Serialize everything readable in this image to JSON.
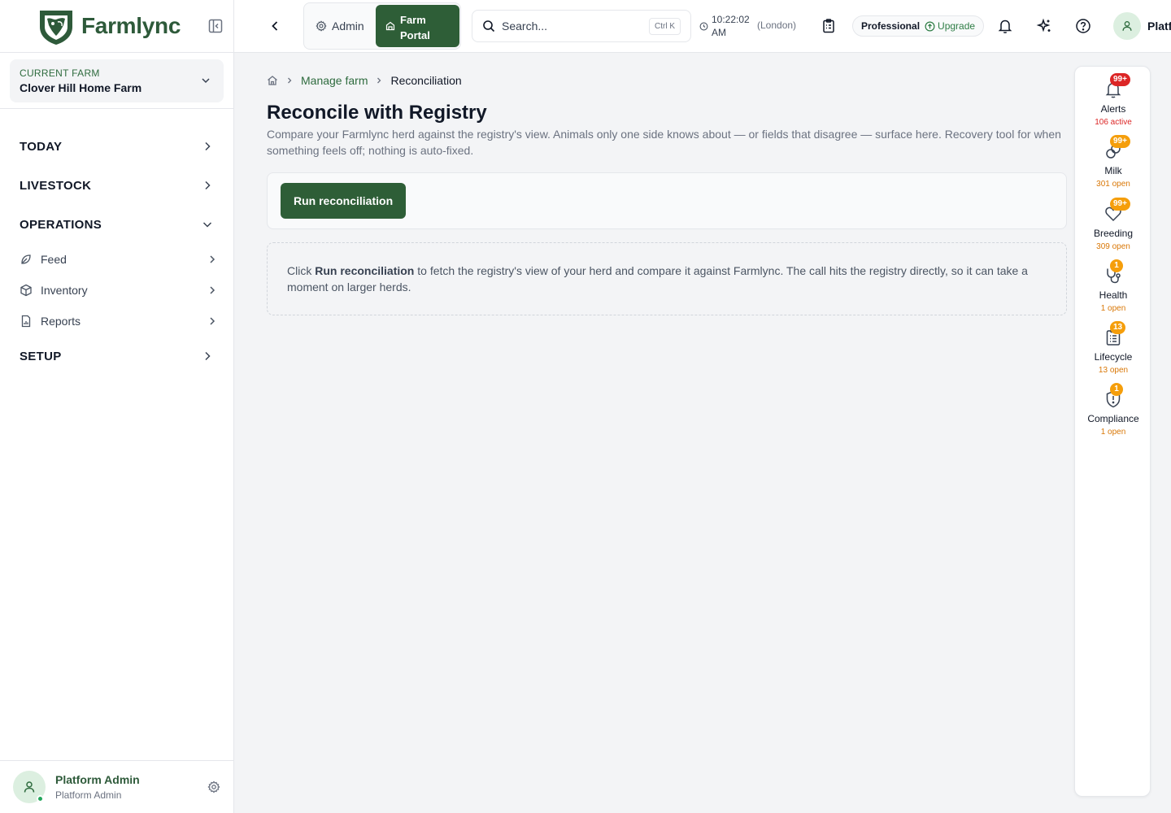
{
  "brand": {
    "name": "Farmlync"
  },
  "sidebar": {
    "farm_label": "CURRENT FARM",
    "farm_name": "Clover Hill Home Farm",
    "sections": [
      {
        "label": "TODAY"
      },
      {
        "label": "LIVESTOCK"
      },
      {
        "label": "OPERATIONS"
      },
      {
        "label": "SETUP"
      }
    ],
    "operations_items": [
      {
        "label": "Feed",
        "icon": "leaf-icon"
      },
      {
        "label": "Inventory",
        "icon": "package-icon"
      },
      {
        "label": "Reports",
        "icon": "report-icon"
      }
    ],
    "user": {
      "name": "Platform Admin",
      "role": "Platform Admin"
    }
  },
  "topbar": {
    "admin_label": "Admin",
    "portal_label_1": "Farm",
    "portal_label_2": "Portal",
    "search_placeholder": "Search...",
    "search_shortcut": "Ctrl K",
    "time_1": "10:22:02",
    "time_2": "AM",
    "timezone": "(London)",
    "plan_name": "Professional",
    "upgrade_label": "Upgrade",
    "profile_name": "Platf"
  },
  "breadcrumb": {
    "link": "Manage farm",
    "current": "Reconciliation"
  },
  "page": {
    "title": "Reconcile with Registry",
    "description": "Compare your Farmlync herd against the registry's view. Animals only one side knows about — or fields that disagree — surface here. Recovery tool for when something feels off; nothing is auto-fixed.",
    "run_button": "Run reconciliation",
    "info_prefix": "Click",
    "info_bold": "Run reconciliation",
    "info_suffix": "to fetch the registry's view of your herd and compare it against Farmlync. The call hits the registry directly, so it can take a moment on larger herds."
  },
  "rail": [
    {
      "label": "Alerts",
      "badge": "99+",
      "sub": "106 active",
      "badge_color": "#dc2626",
      "sub_color": "red",
      "icon": "bell-icon"
    },
    {
      "label": "Milk",
      "badge": "99+",
      "sub": "301 open",
      "badge_color": "#f59e0b",
      "sub_color": "amber",
      "icon": "milk-icon"
    },
    {
      "label": "Breeding",
      "badge": "99+",
      "sub": "309 open",
      "badge_color": "#f59e0b",
      "sub_color": "amber",
      "icon": "heart-icon"
    },
    {
      "label": "Health",
      "badge": "1",
      "sub": "1 open",
      "badge_color": "#f59e0b",
      "sub_color": "amber",
      "icon": "stethoscope-icon"
    },
    {
      "label": "Lifecycle",
      "badge": "13",
      "sub": "13 open",
      "badge_color": "#f59e0b",
      "sub_color": "amber",
      "icon": "clipboard-list-icon"
    },
    {
      "label": "Compliance",
      "badge": "1",
      "sub": "1 open",
      "badge_color": "#f59e0b",
      "sub_color": "amber",
      "icon": "shield-alert-icon"
    }
  ]
}
